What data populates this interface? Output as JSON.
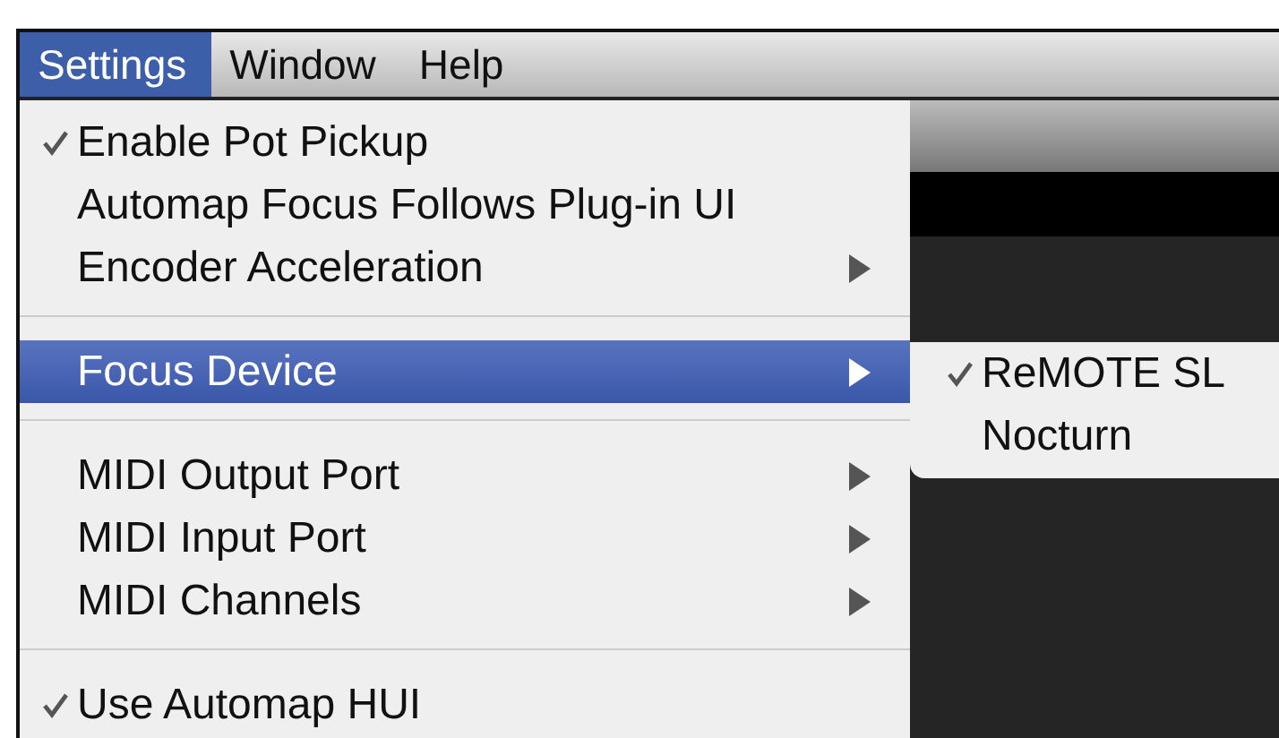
{
  "menubar": [
    {
      "label": "Settings",
      "selected": true
    },
    {
      "label": "Window",
      "selected": false
    },
    {
      "label": "Help",
      "selected": false
    }
  ],
  "menu": [
    {
      "kind": "item",
      "label": "Enable Pot Pickup",
      "checked": true,
      "submenu": false,
      "selected": false
    },
    {
      "kind": "item",
      "label": "Automap Focus Follows Plug-in UI",
      "checked": false,
      "submenu": false,
      "selected": false
    },
    {
      "kind": "item",
      "label": "Encoder Acceleration",
      "checked": false,
      "submenu": true,
      "selected": false
    },
    {
      "kind": "separator"
    },
    {
      "kind": "item",
      "label": "Focus Device",
      "checked": false,
      "submenu": true,
      "selected": true
    },
    {
      "kind": "separator"
    },
    {
      "kind": "item",
      "label": "MIDI Output Port",
      "checked": false,
      "submenu": true,
      "selected": false
    },
    {
      "kind": "item",
      "label": "MIDI Input Port",
      "checked": false,
      "submenu": true,
      "selected": false
    },
    {
      "kind": "item",
      "label": "MIDI Channels",
      "checked": false,
      "submenu": true,
      "selected": false
    },
    {
      "kind": "separator"
    },
    {
      "kind": "item",
      "label": "Use Automap HUI",
      "checked": true,
      "submenu": false,
      "selected": false
    }
  ],
  "submenu": [
    {
      "label": "ReMOTE SL",
      "checked": true
    },
    {
      "label": "Nocturn",
      "checked": false
    }
  ]
}
